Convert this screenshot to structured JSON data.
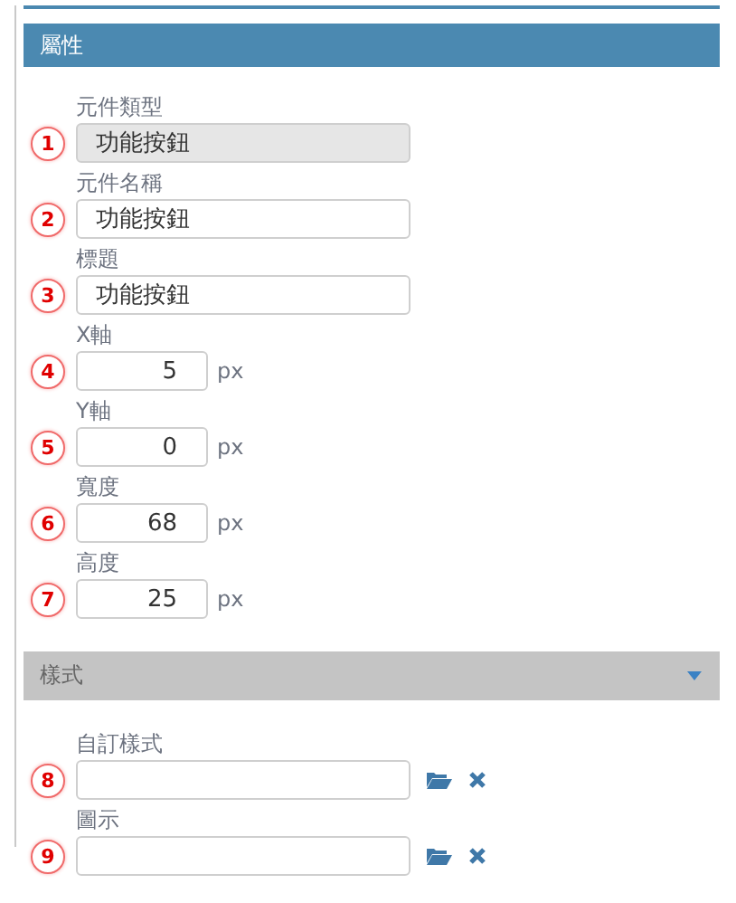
{
  "panel": {
    "title": "屬性"
  },
  "fields": [
    {
      "marker": "1",
      "label": "元件類型",
      "value": "功能按鈕",
      "kind": "text",
      "disabled": true
    },
    {
      "marker": "2",
      "label": "元件名稱",
      "value": "功能按鈕",
      "kind": "text",
      "disabled": false
    },
    {
      "marker": "3",
      "label": "標題",
      "value": "功能按鈕",
      "kind": "text",
      "disabled": false
    },
    {
      "marker": "4",
      "label": "X軸",
      "value": "5",
      "kind": "number",
      "unit": "px",
      "disabled": false
    },
    {
      "marker": "5",
      "label": "Y軸",
      "value": "0",
      "kind": "number",
      "unit": "px",
      "disabled": false
    },
    {
      "marker": "6",
      "label": "寬度",
      "value": "68",
      "kind": "number",
      "unit": "px",
      "disabled": false
    },
    {
      "marker": "7",
      "label": "高度",
      "value": "25",
      "kind": "number",
      "unit": "px",
      "disabled": false
    }
  ],
  "style_section": {
    "title": "樣式",
    "fields": [
      {
        "marker": "8",
        "label": "自訂樣式",
        "kind": "file",
        "disabled": false
      },
      {
        "marker": "9",
        "label": "圖示",
        "kind": "file",
        "disabled": false
      }
    ]
  }
}
